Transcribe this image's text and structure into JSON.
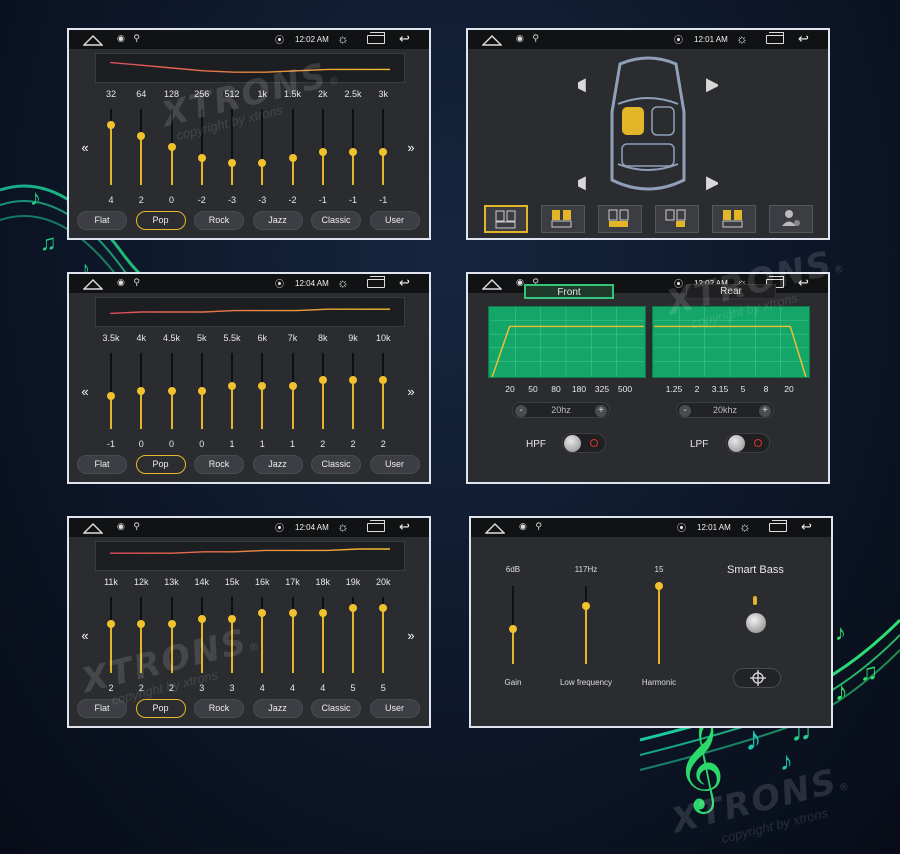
{
  "colors": {
    "accent": "#e2b628",
    "green": "#14a568",
    "panel": "#2a2c30",
    "statusbar": "#111214"
  },
  "eq_panels": [
    {
      "time": "12:02 AM",
      "freqs": [
        "32",
        "64",
        "128",
        "256",
        "512",
        "1k",
        "1.5k",
        "2k",
        "2.5k",
        "3k"
      ],
      "values": [
        "4",
        "2",
        "0",
        "-2",
        "-3",
        "-3",
        "-2",
        "-1",
        "-1",
        "-1"
      ],
      "levels": [
        4,
        2,
        0,
        -2,
        -3,
        -3,
        -2,
        -1,
        -1,
        -1
      ]
    },
    {
      "time": "12:04 AM",
      "freqs": [
        "3.5k",
        "4k",
        "4.5k",
        "5k",
        "5.5k",
        "6k",
        "7k",
        "8k",
        "9k",
        "10k"
      ],
      "values": [
        "-1",
        "0",
        "0",
        "0",
        "1",
        "1",
        "1",
        "2",
        "2",
        "2"
      ],
      "levels": [
        -1,
        0,
        0,
        0,
        1,
        1,
        1,
        2,
        2,
        2
      ]
    },
    {
      "time": "12:04 AM",
      "freqs": [
        "11k",
        "12k",
        "13k",
        "14k",
        "15k",
        "16k",
        "17k",
        "18k",
        "19k",
        "20k"
      ],
      "values": [
        "2",
        "2",
        "2",
        "3",
        "3",
        "4",
        "4",
        "4",
        "5",
        "5"
      ],
      "levels": [
        2,
        2,
        2,
        3,
        3,
        4,
        4,
        4,
        5,
        5
      ]
    }
  ],
  "presets": [
    "Flat",
    "Pop",
    "Rock",
    "Jazz",
    "Classic",
    "User"
  ],
  "active_preset": "Pop",
  "nav": {
    "prev": "«",
    "next": "»"
  },
  "car_panel": {
    "time": "12:01 AM",
    "active_button": 0
  },
  "crossover_panel": {
    "time": "12:02 AM",
    "front_tab": "Front",
    "rear_tab": "Rear",
    "hpf_ticks": [
      "20",
      "50",
      "80",
      "180",
      "325",
      "500"
    ],
    "lpf_ticks": [
      "1.25",
      "2",
      "3.15",
      "5",
      "8",
      "20"
    ],
    "hpf_value": "20hz",
    "lpf_value": "20khz",
    "hpf_label": "HPF",
    "lpf_label": "LPF",
    "minus": "-",
    "plus": "+"
  },
  "bass_panel": {
    "time": "12:01 AM",
    "title": "Smart Bass",
    "gain_value": "6dB",
    "gain_label": "Gain",
    "gain_level": 0.45,
    "low_value": "117Hz",
    "low_label": "Low frequency",
    "low_level": 0.75,
    "harm_value": "15",
    "harm_label": "Harmonic",
    "harm_level": 1.0
  },
  "watermark": {
    "brand": "XTRONS",
    "reg": "®",
    "copyright": "copyright by xtrons"
  }
}
